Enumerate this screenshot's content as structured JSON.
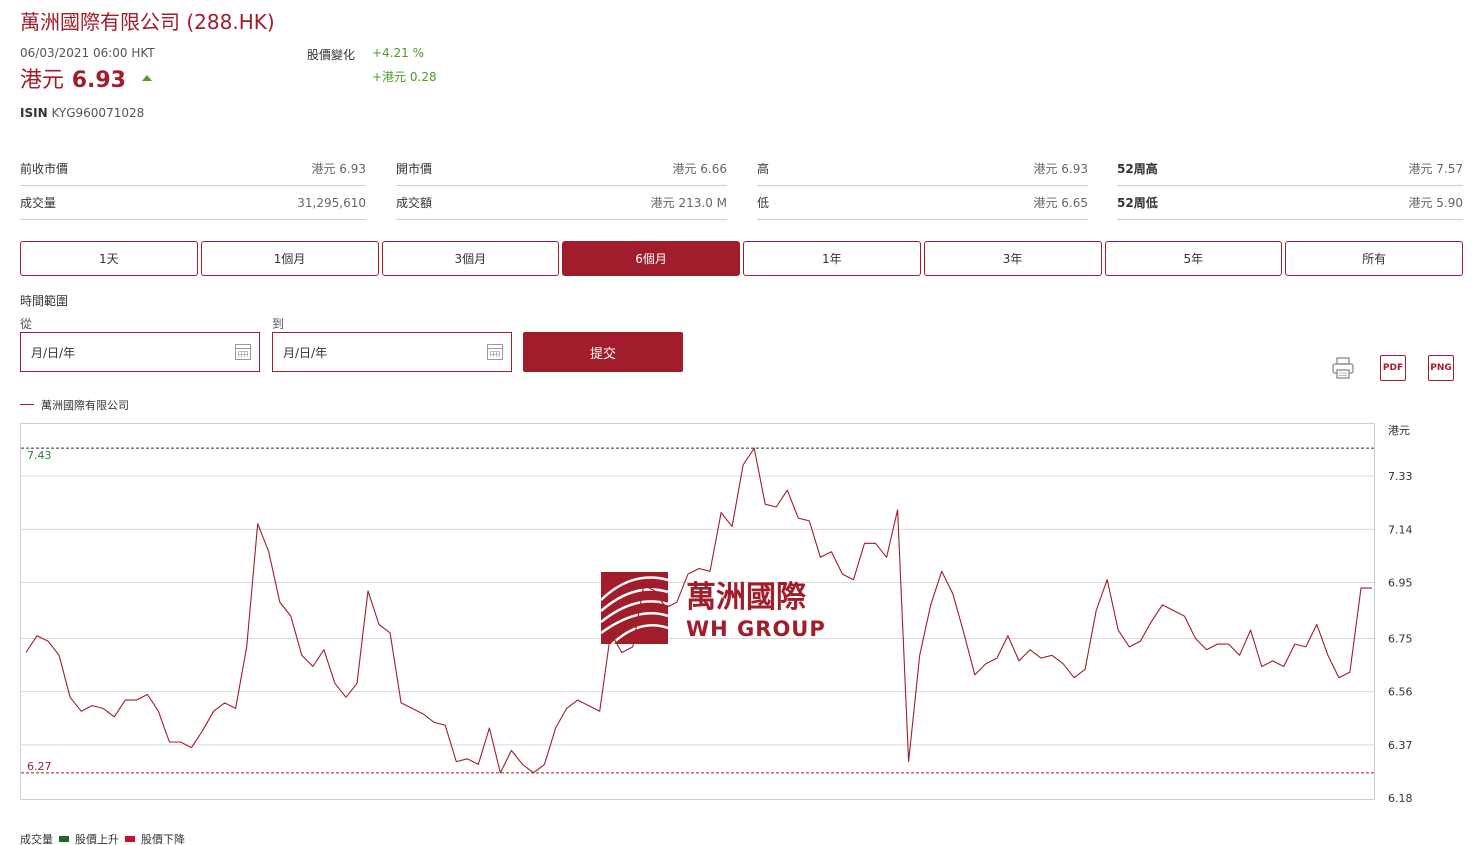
{
  "header": {
    "title": "萬洲國際有限公司 (288.HK)",
    "datetime": "06/03/2021 06:00 HKT",
    "price_currency": "港元",
    "price_value": "6.93",
    "change_label": "股價變化",
    "change_pct": "+4.21 %",
    "change_abs": "+港元 0.28",
    "isin_label": "ISIN",
    "isin_value": "KYG960071028"
  },
  "stats": [
    {
      "label": "前收市價",
      "value": "港元 6.93",
      "bold": false
    },
    {
      "label": "開市價",
      "value": "港元 6.66",
      "bold": false
    },
    {
      "label": "高",
      "value": "港元 6.93",
      "bold": false
    },
    {
      "label": "52周高",
      "value": "港元 7.57",
      "bold": true
    },
    {
      "label": "成交量",
      "value": "31,295,610",
      "bold": false
    },
    {
      "label": "成交額",
      "value": "港元 213.0 M",
      "bold": false
    },
    {
      "label": "低",
      "value": "港元 6.65",
      "bold": false
    },
    {
      "label": "52周低",
      "value": "港元 5.90",
      "bold": true
    }
  ],
  "tabs": [
    {
      "label": "1天",
      "active": false
    },
    {
      "label": "1個月",
      "active": false
    },
    {
      "label": "3個月",
      "active": false
    },
    {
      "label": "6個月",
      "active": true
    },
    {
      "label": "1年",
      "active": false
    },
    {
      "label": "3年",
      "active": false
    },
    {
      "label": "5年",
      "active": false
    },
    {
      "label": "所有",
      "active": false
    }
  ],
  "range": {
    "label": "時間範圍",
    "from_label": "從",
    "to_label": "到",
    "from_value": "月/日/年",
    "to_value": "月/日/年",
    "submit_label": "提交"
  },
  "export": {
    "pdf_label": "PDF",
    "png_label": "PNG"
  },
  "colors": {
    "accent": "#a11d2b",
    "up": "#1f6b1f",
    "down": "#c8102e",
    "positive_text": "#4c9a2a",
    "high_line": "#2e7d32"
  },
  "watermark": {
    "cn": "萬洲國際",
    "en": "WH GROUP"
  },
  "bottom_legend": {
    "volume": "成交量",
    "up": "股價上升",
    "down": "股價下降"
  },
  "chart_data": {
    "type": "line",
    "legend": [
      "萬洲國際有限公司"
    ],
    "ylabel": "港元",
    "ylim": [
      6.18,
      7.52
    ],
    "yticks": [
      6.18,
      6.37,
      6.56,
      6.75,
      6.95,
      7.14,
      7.33
    ],
    "ytick_labels": [
      "6.18",
      "6.37",
      "6.56",
      "6.75",
      "6.95",
      "7.14",
      "7.33"
    ],
    "high_ref": {
      "value": 7.43,
      "label": "7.43"
    },
    "low_ref": {
      "value": 6.27,
      "label": "6.27"
    },
    "grid": true,
    "series": [
      {
        "name": "萬洲國際有限公司",
        "values": [
          6.7,
          6.76,
          6.74,
          6.69,
          6.54,
          6.49,
          6.51,
          6.5,
          6.47,
          6.53,
          6.53,
          6.55,
          6.49,
          6.38,
          6.38,
          6.36,
          6.42,
          6.49,
          6.52,
          6.5,
          6.72,
          7.16,
          7.06,
          6.88,
          6.83,
          6.69,
          6.65,
          6.71,
          6.59,
          6.54,
          6.59,
          6.92,
          6.8,
          6.77,
          6.52,
          6.5,
          6.48,
          6.45,
          6.44,
          6.31,
          6.32,
          6.3,
          6.43,
          6.27,
          6.35,
          6.3,
          6.27,
          6.3,
          6.43,
          6.5,
          6.53,
          6.51,
          6.49,
          6.77,
          6.7,
          6.72,
          6.94,
          6.92,
          6.86,
          6.88,
          6.98,
          7.0,
          6.99,
          7.2,
          7.15,
          7.37,
          7.43,
          7.23,
          7.22,
          7.28,
          7.18,
          7.17,
          7.04,
          7.06,
          6.98,
          6.96,
          7.09,
          7.09,
          7.04,
          7.21,
          6.31,
          6.69,
          6.87,
          6.99,
          6.91,
          6.77,
          6.62,
          6.66,
          6.68,
          6.76,
          6.67,
          6.71,
          6.68,
          6.69,
          6.66,
          6.61,
          6.64,
          6.85,
          6.96,
          6.78,
          6.72,
          6.74,
          6.81,
          6.87,
          6.85,
          6.83,
          6.75,
          6.71,
          6.73,
          6.73,
          6.69,
          6.78,
          6.65,
          6.67,
          6.65,
          6.73,
          6.72,
          6.8,
          6.69,
          6.61,
          6.63,
          6.93,
          6.93
        ]
      }
    ]
  }
}
